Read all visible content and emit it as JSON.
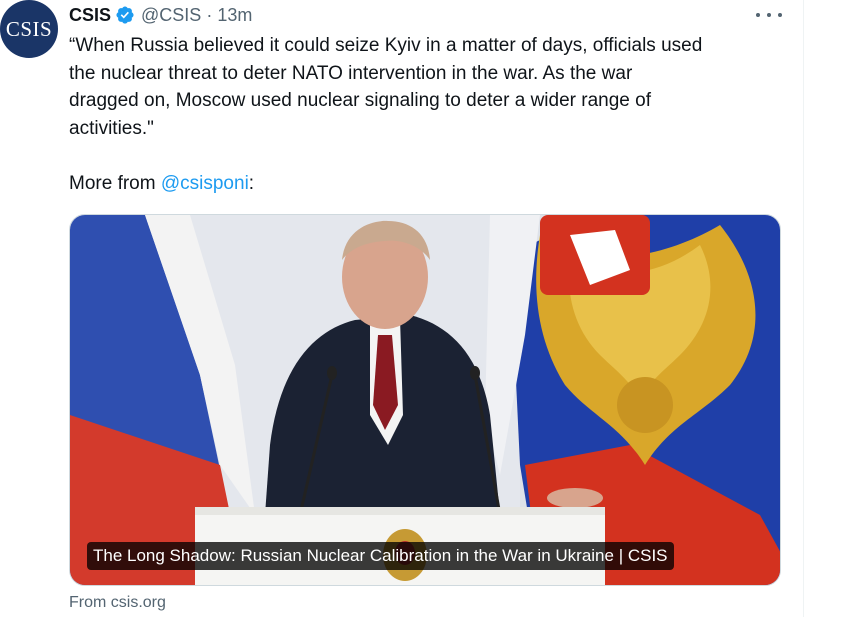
{
  "tweet": {
    "avatar_text": "CSIS",
    "author_name": "CSIS",
    "handle": "@CSIS",
    "separator": "·",
    "time": "13m",
    "text": "“When Russia believed it could seize Kyiv in a matter of days, officials used\nthe nuclear threat to deter NATO intervention in the war. As the war\ndragged on, Moscow used nuclear signaling to deter a wider range of\nactivities.\"",
    "more_prefix": "More from ",
    "mention": "@csisponi",
    "more_suffix": ":"
  },
  "link_card": {
    "title": "The Long Shadow: Russian Nuclear Calibration in the War in Ukraine | CSIS",
    "source": "From csis.org"
  },
  "icons": {
    "verified": "verified-badge-icon",
    "more": "more-options-icon"
  },
  "colors": {
    "accent": "#1d9bf0",
    "secondary_text": "#536471",
    "primary_text": "#0f1419",
    "avatar_bg": "#1a3567"
  }
}
